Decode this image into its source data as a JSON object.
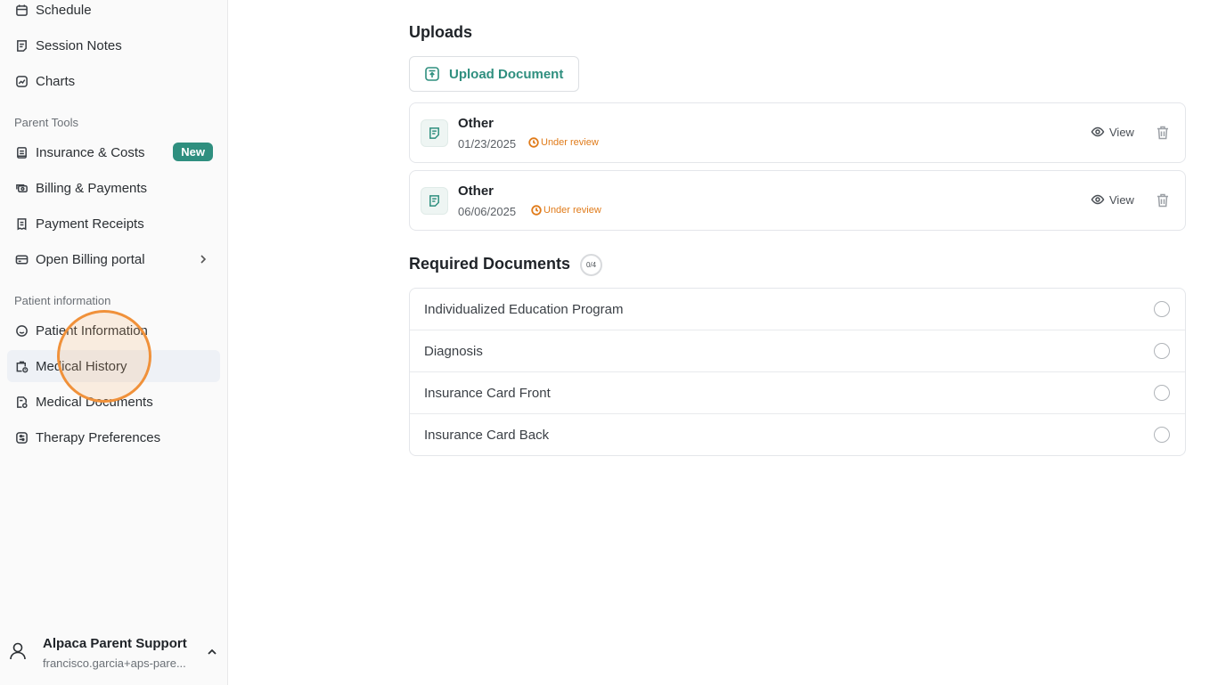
{
  "sidebar": {
    "items_top": [
      {
        "label": "Schedule",
        "icon": "calendar-icon"
      },
      {
        "label": "Session Notes",
        "icon": "notes-icon"
      },
      {
        "label": "Charts",
        "icon": "chart-icon"
      }
    ],
    "section_parent_tools": "Parent Tools",
    "parent_tools": [
      {
        "label": "Insurance & Costs",
        "icon": "insurance-icon",
        "badge": "New"
      },
      {
        "label": "Billing & Payments",
        "icon": "billing-icon"
      },
      {
        "label": "Payment Receipts",
        "icon": "receipt-icon"
      },
      {
        "label": "Open Billing portal",
        "icon": "card-icon"
      }
    ],
    "section_patient": "Patient information",
    "patient_items": [
      {
        "label": "Patient Information",
        "icon": "smile-icon"
      },
      {
        "label": "Medical History",
        "icon": "medical-bag-icon",
        "active": true
      },
      {
        "label": "Medical Documents",
        "icon": "document-icon"
      },
      {
        "label": "Therapy Preferences",
        "icon": "preferences-icon"
      }
    ],
    "user": {
      "name": "Alpaca Parent Support",
      "email": "francisco.garcia+aps-pare..."
    }
  },
  "main": {
    "uploads_heading": "Uploads",
    "upload_button": "Upload Document",
    "documents": [
      {
        "title": "Other",
        "date": "01/23/2025",
        "status": "Under review",
        "view": "View"
      },
      {
        "title": "Other",
        "date": "06/06/2025",
        "status": "Under review",
        "view": "View"
      }
    ],
    "required_heading": "Required Documents",
    "required_count": "0/4",
    "required_docs": [
      "Individualized Education Program",
      "Diagnosis",
      "Insurance Card Front",
      "Insurance Card Back"
    ]
  },
  "colors": {
    "accent": "#2f8f7f",
    "status_warning": "#e07b1a",
    "cursor_ring": "#f0913a"
  }
}
